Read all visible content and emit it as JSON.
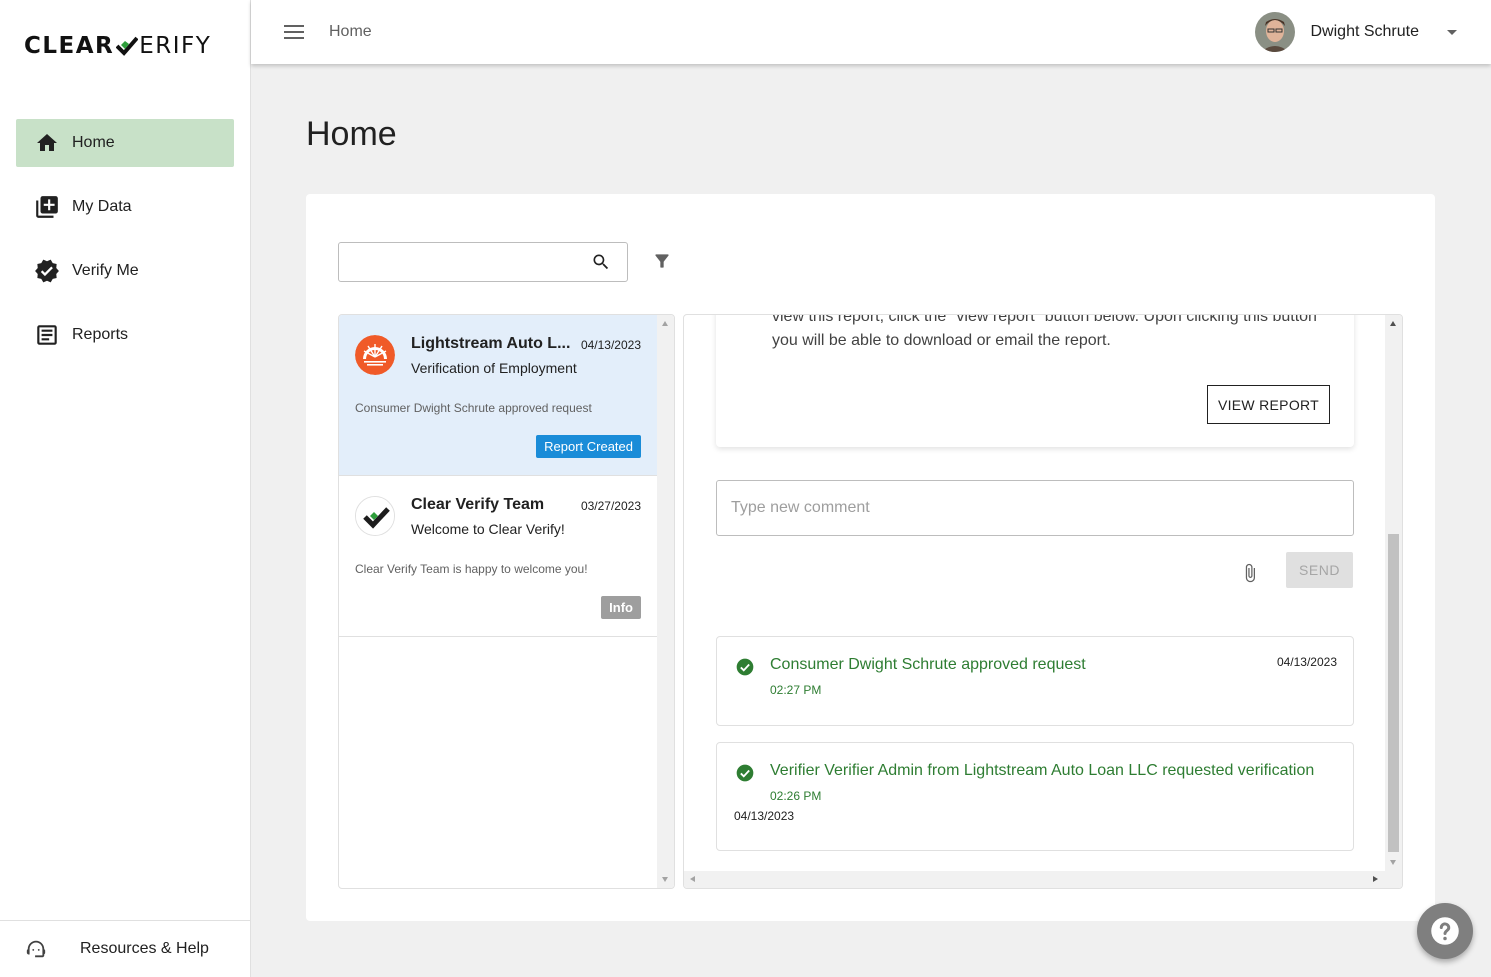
{
  "brand": {
    "name_bold": "CLEAR",
    "name_light": "ERIFY",
    "accent": "#2e7d32"
  },
  "sidebar": {
    "items": [
      {
        "label": "Home",
        "icon": "home-icon",
        "active": true
      },
      {
        "label": "My Data",
        "icon": "add-document-icon",
        "active": false
      },
      {
        "label": "Verify Me",
        "icon": "verified-badge-icon",
        "active": false
      },
      {
        "label": "Reports",
        "icon": "report-icon",
        "active": false
      }
    ],
    "footer": {
      "label": "Resources & Help",
      "icon": "support-agent-icon"
    }
  },
  "topbar": {
    "breadcrumb": "Home",
    "user_name": "Dwight Schrute"
  },
  "page": {
    "title": "Home"
  },
  "search": {
    "placeholder": "",
    "value": ""
  },
  "messages": [
    {
      "title": "Lightstream Auto L...",
      "date": "04/13/2023",
      "subtitle": "Verification of Employment",
      "message": "Consumer Dwight Schrute approved request",
      "badge": "Report Created",
      "badge_color": "#1a8cd8",
      "selected": true
    },
    {
      "title": "Clear Verify Team",
      "date": "03/27/2023",
      "subtitle": "Welcome to Clear Verify!",
      "message": "Clear Verify Team is happy to welcome you!",
      "badge": "Info",
      "badge_color": "#9e9e9e",
      "selected": false
    }
  ],
  "detail": {
    "report_text_line1": "view this report, click the \"view report\" button below. Upon clicking this button",
    "report_text_line2": "you will be able to download or email the report.",
    "view_report_label": "VIEW REPORT",
    "comment_placeholder": "Type new comment",
    "send_label": "SEND",
    "activity": [
      {
        "text": "Consumer Dwight Schrute approved request",
        "time": "02:27 PM",
        "date": "04/13/2023"
      },
      {
        "text": "Verifier Verifier Admin from Lightstream Auto Loan LLC requested verification",
        "time": "02:26 PM",
        "date": "04/13/2023"
      }
    ]
  }
}
